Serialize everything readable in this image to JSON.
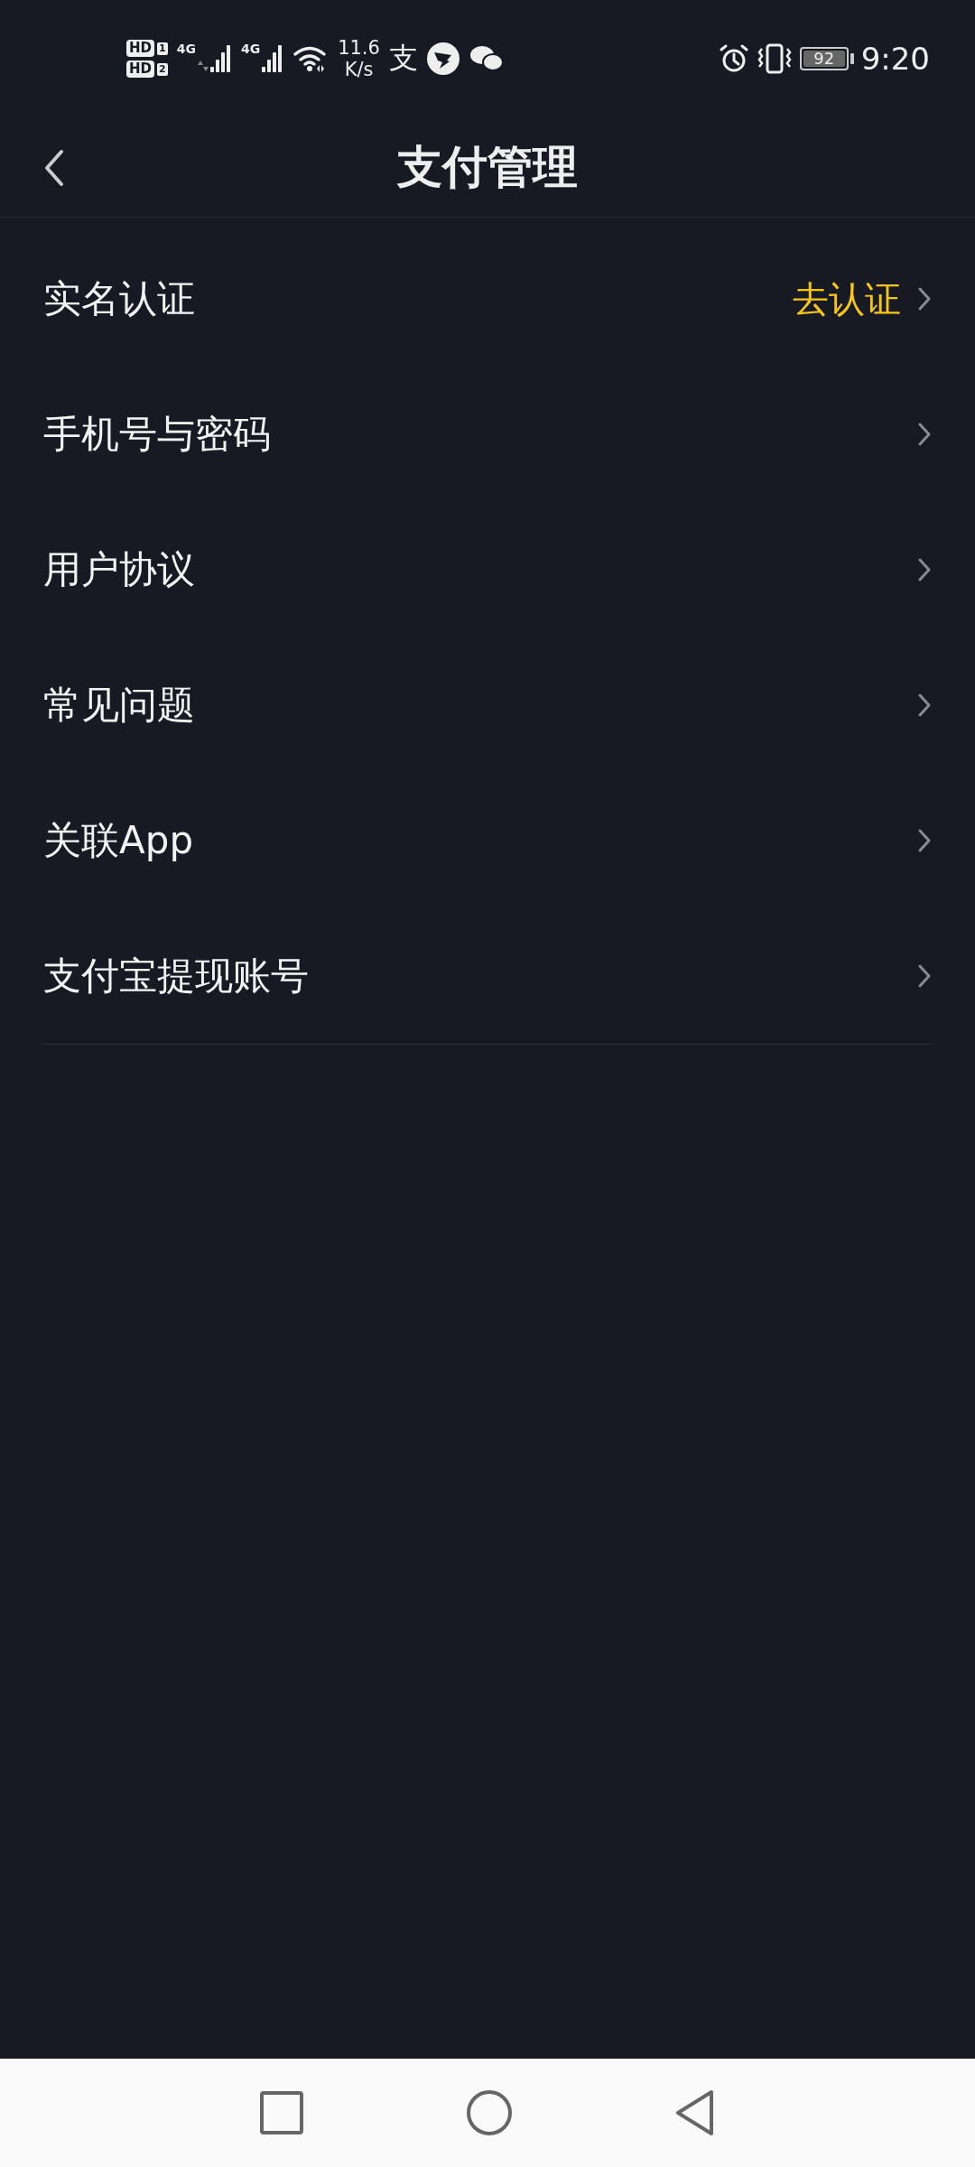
{
  "status_bar": {
    "sims": [
      {
        "badge": "HD",
        "slot": "1"
      },
      {
        "badge": "HD",
        "slot": "2"
      }
    ],
    "networks": [
      {
        "label": "4G",
        "data_arrows": true
      },
      {
        "label": "4G",
        "data_arrows": false
      }
    ],
    "speed": [
      "11.6",
      "K/s"
    ],
    "alipay_glyph": "支",
    "battery": "92",
    "time": "9:20"
  },
  "header": {
    "title": "支付管理"
  },
  "rows": [
    {
      "label": "实名认证",
      "value": "去认证"
    },
    {
      "label": "手机号与密码"
    },
    {
      "label": "用户协议"
    },
    {
      "label": "常见问题"
    },
    {
      "label": "关联App"
    },
    {
      "label": "支付宝提现账号"
    }
  ]
}
